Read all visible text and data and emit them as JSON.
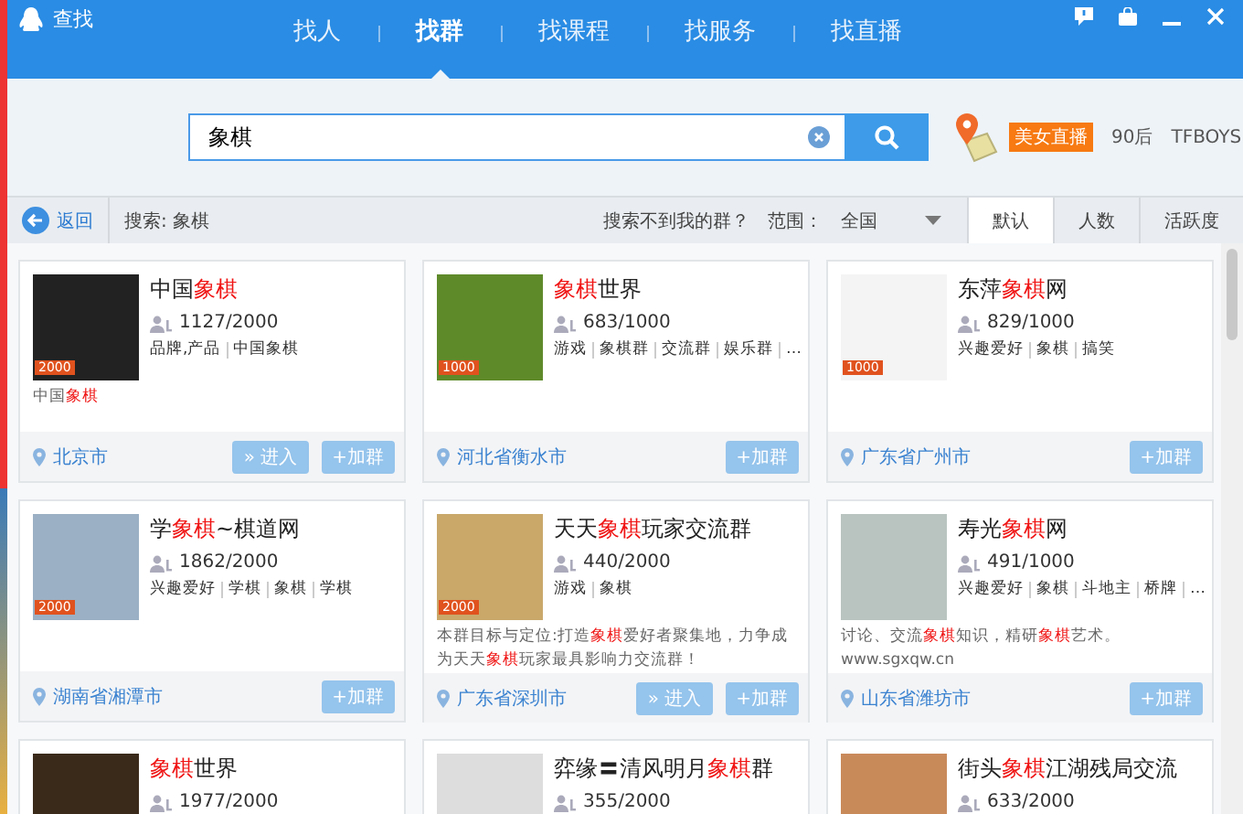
{
  "window": {
    "title": "查找"
  },
  "tabs": [
    {
      "label": "找人",
      "selected": false
    },
    {
      "label": "找群",
      "selected": true
    },
    {
      "label": "找课程",
      "selected": false
    },
    {
      "label": "找服务",
      "selected": false
    },
    {
      "label": "找直播",
      "selected": false
    }
  ],
  "search": {
    "value": "象棋"
  },
  "hot_tags": [
    {
      "label": "美女直播",
      "kind": "highlight"
    },
    {
      "label": "90后",
      "kind": "plain"
    },
    {
      "label": "TFBOYS",
      "kind": "plain"
    }
  ],
  "filter_bar": {
    "back": "返回",
    "query": "搜索: 象棋",
    "not_found": "搜索不到我的群？",
    "range_label": "范围：",
    "range_value": "全国",
    "sort": [
      {
        "label": "默认",
        "selected": true
      },
      {
        "label": "人数",
        "selected": false
      },
      {
        "label": "活跃度",
        "selected": false
      }
    ]
  },
  "groups": [
    {
      "name": "中国**象棋**",
      "members": "1127/2000",
      "badge": "2000",
      "tags": [
        "品牌,产品",
        "中国象棋"
      ],
      "description": "中国**象棋**",
      "location": "北京市",
      "buttons": [
        "» 进入",
        "+加群"
      ]
    },
    {
      "name": "**象棋**世界",
      "members": "683/1000",
      "badge": "1000",
      "tags": [
        "游戏",
        "象棋群",
        "交流群",
        "娱乐群",
        "…"
      ],
      "location": "河北省衡水市",
      "buttons": [
        "+加群"
      ]
    },
    {
      "name": "东萍**象棋**网",
      "members": "829/1000",
      "badge": "1000",
      "tags": [
        "兴趣爱好",
        "象棋",
        "搞笑"
      ],
      "location": "广东省广州市",
      "buttons": [
        "+加群"
      ]
    },
    {
      "name": "学**象棋**~棋道网",
      "members": "1862/2000",
      "badge": "2000",
      "tags": [
        "兴趣爱好",
        "学棋",
        "象棋",
        "学棋"
      ],
      "location": "湖南省湘潭市",
      "buttons": [
        "+加群"
      ]
    },
    {
      "name": "天天**象棋**玩家交流群",
      "members": "440/2000",
      "badge": "2000",
      "tags": [
        "游戏",
        "象棋"
      ],
      "description": "本群目标与定位:打造**象棋**爱好者聚集地，力争成为天天**象棋**玩家最具影响力交流群！",
      "location": "广东省深圳市",
      "buttons": [
        "» 进入",
        "+加群"
      ]
    },
    {
      "name": "寿光**象棋**网",
      "members": "491/1000",
      "tags": [
        "兴趣爱好",
        "象棋",
        "斗地主",
        "桥牌",
        "…"
      ],
      "description": "讨论、交流**象棋**知识，精研**象棋**艺术。www.sgxqw.cn",
      "location": "山东省潍坊市",
      "buttons": [
        "+加群"
      ]
    },
    {
      "name": "**象棋**世界",
      "members": "1977/2000"
    },
    {
      "name": "弈缘〓清风明月**象棋**群",
      "members": "355/2000"
    },
    {
      "name": "街头**象棋**江湖残局交流",
      "members": "633/2000"
    }
  ]
}
